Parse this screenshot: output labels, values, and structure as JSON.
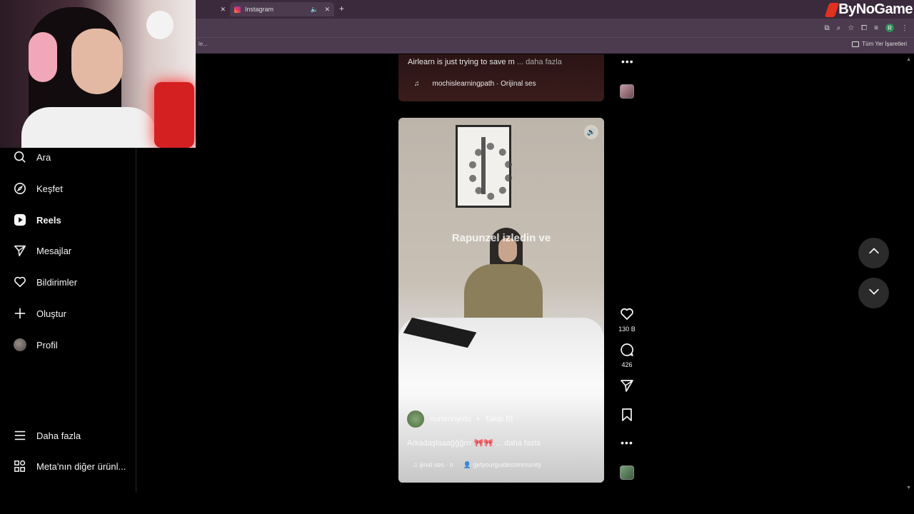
{
  "browser": {
    "tabs": [
      {
        "label": ""
      },
      {
        "label": "Instagram"
      }
    ],
    "bookmark_left": "le...",
    "bookmark_right": "Tüm Yer İşaretleri",
    "profile_letter": "R"
  },
  "logo": {
    "text": "ByNoGame",
    "color": "#e0301e"
  },
  "sidebar": {
    "items": [
      {
        "label": "Ara",
        "icon": "search-icon"
      },
      {
        "label": "Keşfet",
        "icon": "compass-icon"
      },
      {
        "label": "Reels",
        "icon": "reels-icon"
      },
      {
        "label": "Mesajlar",
        "icon": "send-icon"
      },
      {
        "label": "Bildirimler",
        "icon": "heart-icon"
      },
      {
        "label": "Oluştur",
        "icon": "plus-icon"
      },
      {
        "label": "Profil",
        "icon": "avatar"
      }
    ],
    "bottom": [
      {
        "label": "Daha fazla",
        "icon": "menu-icon"
      },
      {
        "label": "Meta'nın diğer ürünl...",
        "icon": "grid-icon"
      }
    ]
  },
  "previous_post": {
    "caption": "Airlearn is just trying to save m",
    "more": "... daha fazla",
    "audio_icon": "music-icon",
    "audio": "mochislearningpath · Orijinal ses"
  },
  "reel": {
    "overlay_text": "Rapunzel izledin ve",
    "username": "nurtennyulu",
    "follow_sep": "•",
    "follow": "Takip Et",
    "caption": "Arkadaşlaaağğğrrr 🎀🎀",
    "more": "... daha fazla",
    "audio": "ijinal ses · n",
    "tagged": "getyourguidecommunity"
  },
  "actions": {
    "likes": "130 B",
    "comments": "426"
  },
  "colors": {
    "accent": "#e1306c",
    "background": "#000000",
    "chrome": "#4c3a4e"
  }
}
